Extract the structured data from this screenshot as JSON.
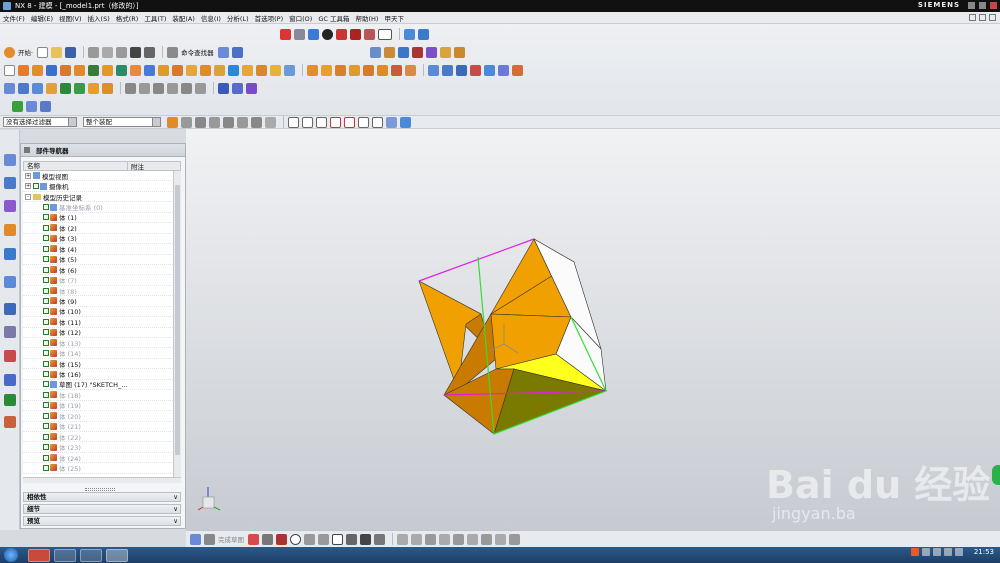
{
  "window": {
    "title": "NX 8 - 建模 - [_model1.prt（修改的）]",
    "brand": "SIEMENS"
  },
  "menubar": {
    "items": [
      "文件(F)",
      "编辑(E)",
      "视图(V)",
      "插入(S)",
      "格式(R)",
      "工具(T)",
      "装配(A)",
      "信息(I)",
      "分析(L)",
      "首选项(P)",
      "窗口(O)",
      "GC 工具箱",
      "帮助(H)",
      "甲天下"
    ]
  },
  "toolbar": {
    "start_label": "开始·",
    "command_finder_label": "命令查找器"
  },
  "selection": {
    "filter_value": "没有选择过滤器",
    "scope_value": "整个装配"
  },
  "navigator": {
    "title": "部件导航器",
    "col_name": "名称",
    "col_attach": "附注",
    "nodes": [
      {
        "label": "模型视图",
        "level": 0,
        "type": "views",
        "expand": "+"
      },
      {
        "label": "摄像机",
        "level": 0,
        "type": "camera",
        "expand": "+"
      },
      {
        "label": "模型历史记录",
        "level": 0,
        "type": "folder",
        "expand": "-"
      },
      {
        "label": "基准坐标系 (0)",
        "level": 1,
        "type": "datum",
        "dim": true
      },
      {
        "label": "体 (1)",
        "level": 1,
        "type": "body"
      },
      {
        "label": "体 (2)",
        "level": 1,
        "type": "body"
      },
      {
        "label": "体 (3)",
        "level": 1,
        "type": "body"
      },
      {
        "label": "体 (4)",
        "level": 1,
        "type": "body"
      },
      {
        "label": "体 (5)",
        "level": 1,
        "type": "body"
      },
      {
        "label": "体 (6)",
        "level": 1,
        "type": "body"
      },
      {
        "label": "体 (7)",
        "level": 1,
        "type": "body",
        "dim": true
      },
      {
        "label": "体 (8)",
        "level": 1,
        "type": "body",
        "dim": true
      },
      {
        "label": "体 (9)",
        "level": 1,
        "type": "body"
      },
      {
        "label": "体 (10)",
        "level": 1,
        "type": "body"
      },
      {
        "label": "体 (11)",
        "level": 1,
        "type": "body"
      },
      {
        "label": "体 (12)",
        "level": 1,
        "type": "body"
      },
      {
        "label": "体 (13)",
        "level": 1,
        "type": "body",
        "dim": true
      },
      {
        "label": "体 (14)",
        "level": 1,
        "type": "body",
        "dim": true
      },
      {
        "label": "体 (15)",
        "level": 1,
        "type": "body"
      },
      {
        "label": "体 (16)",
        "level": 1,
        "type": "body"
      },
      {
        "label": "草图 (17) \"SKETCH_...",
        "level": 1,
        "type": "sketch"
      },
      {
        "label": "体 (18)",
        "level": 1,
        "type": "body",
        "dim": true
      },
      {
        "label": "体 (19)",
        "level": 1,
        "type": "body",
        "dim": true
      },
      {
        "label": "体 (20)",
        "level": 1,
        "type": "body",
        "dim": true
      },
      {
        "label": "体 (21)",
        "level": 1,
        "type": "body",
        "dim": true
      },
      {
        "label": "体 (22)",
        "level": 1,
        "type": "body",
        "dim": true
      },
      {
        "label": "体 (23)",
        "level": 1,
        "type": "body",
        "dim": true
      },
      {
        "label": "体 (24)",
        "level": 1,
        "type": "body",
        "dim": true
      },
      {
        "label": "体 (25)",
        "level": 1,
        "type": "body",
        "dim": true
      }
    ],
    "sections": [
      "相依性",
      "细节",
      "预览"
    ]
  },
  "sketch_toolbar": {
    "label": "完成草图"
  },
  "watermark": {
    "main": "Bai du 经验",
    "sub": "jingyan.ba"
  },
  "taskbar": {
    "clock": "21:53"
  },
  "colors": {
    "orange": "#f0a000",
    "orange_dark": "#c97a00",
    "yellow": "#ffff1e",
    "olive": "#7a7a00",
    "white_face": "#fbfbfb",
    "edge_magenta": "#e020e0",
    "edge_green": "#30e030"
  }
}
